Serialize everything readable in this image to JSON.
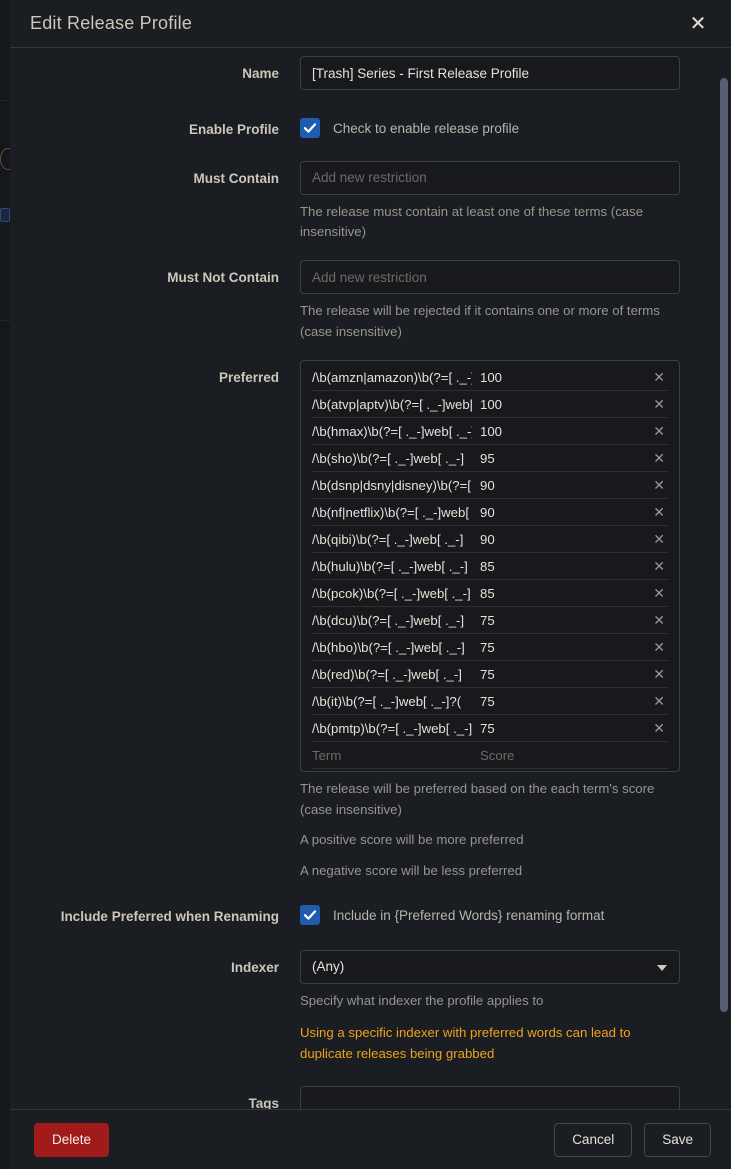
{
  "modal": {
    "title": "Edit Release Profile",
    "close_icon": "close-icon"
  },
  "fields": {
    "name": {
      "label": "Name",
      "value": "[Trash] Series - First Release Profile"
    },
    "enable_profile": {
      "label": "Enable Profile",
      "checkbox_label": "Check to enable release profile",
      "checked": true
    },
    "must_contain": {
      "label": "Must Contain",
      "placeholder": "Add new restriction",
      "help": "The release must contain at least one of these terms (case insensitive)"
    },
    "must_not_contain": {
      "label": "Must Not Contain",
      "placeholder": "Add new restriction",
      "help": "The release will be rejected if it contains one or more of terms (case insensitive)"
    },
    "preferred": {
      "label": "Preferred",
      "term_placeholder": "Term",
      "score_placeholder": "Score",
      "delete_icon": "close-icon",
      "help_1": "The release will be preferred based on the each term's score (case insensitive)",
      "help_2": "A positive score will be more preferred",
      "help_3": "A negative score will be less preferred",
      "rows": [
        {
          "term": "/\\b(amzn|amazon)\\b(?=[ ._-]web[ ._-]",
          "score": "100"
        },
        {
          "term": "/\\b(atvp|aptv)\\b(?=[ ._-]web[ ._-]",
          "score": "100"
        },
        {
          "term": "/\\b(hmax)\\b(?=[ ._-]web[ ._-]",
          "score": "100"
        },
        {
          "term": "/\\b(sho)\\b(?=[ ._-]web[ ._-]",
          "score": "95"
        },
        {
          "term": "/\\b(dsnp|dsny|disney)\\b(?=[ ._-]",
          "score": "90"
        },
        {
          "term": "/\\b(nf|netflix)\\b(?=[ ._-]web[ ._-]",
          "score": "90"
        },
        {
          "term": "/\\b(qibi)\\b(?=[ ._-]web[ ._-]",
          "score": "90"
        },
        {
          "term": "/\\b(hulu)\\b(?=[ ._-]web[ ._-]",
          "score": "85"
        },
        {
          "term": "/\\b(pcok)\\b(?=[ ._-]web[ ._-]",
          "score": "85"
        },
        {
          "term": "/\\b(dcu)\\b(?=[ ._-]web[ ._-]",
          "score": "75"
        },
        {
          "term": "/\\b(hbo)\\b(?=[ ._-]web[ ._-]",
          "score": "75"
        },
        {
          "term": "/\\b(red)\\b(?=[ ._-]web[ ._-]",
          "score": "75"
        },
        {
          "term": "/\\b(it)\\b(?=[ ._-]web[ ._-]?(",
          "score": "75"
        },
        {
          "term": "/\\b(pmtp)\\b(?=[ ._-]web[ ._-]",
          "score": "75"
        }
      ]
    },
    "include_preferred": {
      "label": "Include Preferred when Renaming",
      "checkbox_label": "Include in {Preferred Words} renaming format",
      "checked": true
    },
    "indexer": {
      "label": "Indexer",
      "value": "(Any)",
      "caret_icon": "chevron-down-icon",
      "help": "Specify what indexer the profile applies to",
      "warning": "Using a specific indexer with preferred words can lead to duplicate releases being grabbed"
    },
    "tags": {
      "label": "Tags",
      "value": ""
    }
  },
  "footer": {
    "delete_label": "Delete",
    "cancel_label": "Cancel",
    "save_label": "Save"
  },
  "colors": {
    "accent_blue": "#1f5cb0",
    "danger_red": "#a21b1b",
    "warning_orange": "#f0a21c",
    "modal_bg": "#1a1d21",
    "input_bg": "#17191d"
  }
}
